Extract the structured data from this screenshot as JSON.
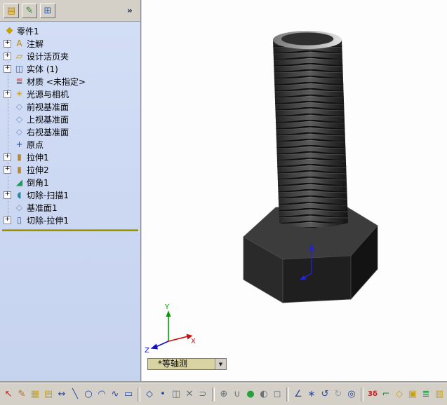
{
  "left_panel": {
    "toolbar": {
      "buttons": [
        {
          "id": "featuremanager-tab",
          "icon": "featuremanager-tree-icon",
          "glyph": "▤",
          "color": "#b8860b"
        },
        {
          "id": "propertymanager-tab",
          "icon": "propertymanager-icon",
          "glyph": "✎",
          "color": "#2a8a2a"
        },
        {
          "id": "configurationmanager-tab",
          "icon": "configurationmanager-icon",
          "glyph": "⊞",
          "color": "#3060b0"
        }
      ],
      "chevron": "»"
    },
    "tree": {
      "root": {
        "id": "part1",
        "label": "零件1",
        "glyph": "◆",
        "color": "#c8a000"
      },
      "expand_glyph": "+",
      "items": [
        {
          "id": "annotations",
          "label": "注解",
          "plus": true,
          "icon": "annotations-icon",
          "glyph": "A",
          "color": "#b8860b"
        },
        {
          "id": "design-binder",
          "label": "设计活页夹",
          "plus": true,
          "icon": "design-binder-icon",
          "glyph": "▱",
          "color": "#c09020"
        },
        {
          "id": "solid-bodies",
          "label": "实体 (1)",
          "plus": true,
          "icon": "solid-bodies-icon",
          "glyph": "◫",
          "color": "#3858b8"
        },
        {
          "id": "material",
          "label": "材质 <未指定>",
          "plus": false,
          "icon": "material-icon",
          "glyph": "≣",
          "color": "#c03030"
        },
        {
          "id": "lights-cameras",
          "label": "光源与相机",
          "plus": true,
          "icon": "lights-cameras-icon",
          "glyph": "☀",
          "color": "#d8a000"
        },
        {
          "id": "front-plane",
          "label": "前视基准面",
          "plus": false,
          "icon": "plane-icon",
          "glyph": "◇",
          "color": "#7090c8"
        },
        {
          "id": "top-plane",
          "label": "上视基准面",
          "plus": false,
          "icon": "plane-icon",
          "glyph": "◇",
          "color": "#7090c8"
        },
        {
          "id": "right-plane",
          "label": "右视基准面",
          "plus": false,
          "icon": "plane-icon",
          "glyph": "◇",
          "color": "#7090c8"
        },
        {
          "id": "origin",
          "label": "原点",
          "plus": false,
          "icon": "origin-icon",
          "glyph": "+",
          "color": "#2040c0"
        },
        {
          "id": "extrude1",
          "label": "拉伸1",
          "plus": true,
          "icon": "boss-extrude-icon",
          "glyph": "▮",
          "color": "#b8862a"
        },
        {
          "id": "extrude2",
          "label": "拉伸2",
          "plus": true,
          "icon": "boss-extrude-icon",
          "glyph": "▮",
          "color": "#b8862a"
        },
        {
          "id": "chamfer1",
          "label": "倒角1",
          "plus": false,
          "icon": "chamfer-icon",
          "glyph": "◢",
          "color": "#209858"
        },
        {
          "id": "cut-sweep1",
          "label": "切除-扫描1",
          "plus": true,
          "icon": "cut-sweep-icon",
          "glyph": "◖",
          "color": "#2888a0"
        },
        {
          "id": "plane1",
          "label": "基准面1",
          "plus": false,
          "icon": "plane-icon",
          "glyph": "◇",
          "color": "#7090c8"
        },
        {
          "id": "cut-extrude1",
          "label": "切除-拉伸1",
          "plus": true,
          "icon": "cut-extrude-icon",
          "glyph": "▯",
          "color": "#3858b8"
        }
      ]
    }
  },
  "viewport": {
    "view_combo": {
      "value": "*等轴测",
      "arrow": "▼"
    },
    "triad": {
      "x": "X",
      "y": "Y",
      "z": "Z"
    },
    "colors": {
      "x_axis": "#cc1010",
      "y_axis": "#00a000",
      "z_axis": "#1010cc",
      "origin_marker": "#2424cc"
    }
  },
  "bottom_toolbar": {
    "icons": [
      {
        "id": "select-arrow-icon",
        "glyph": "↖",
        "color": "#b02818"
      },
      {
        "id": "sketch-icon",
        "glyph": "✎",
        "color": "#c06818"
      },
      {
        "id": "grid-icon",
        "glyph": "▦",
        "color": "#c8a018"
      },
      {
        "id": "note-icon",
        "glyph": "▤",
        "color": "#c8a018"
      },
      {
        "id": "dimension-icon",
        "glyph": "↔",
        "color": "#2848a0"
      },
      {
        "id": "line-icon",
        "glyph": "╲",
        "color": "#2848a0"
      },
      {
        "id": "circle-icon",
        "glyph": "○",
        "color": "#2848a0"
      },
      {
        "id": "arc-icon",
        "glyph": "◠",
        "color": "#2848a0"
      },
      {
        "id": "spline-icon",
        "glyph": "∿",
        "color": "#2848a0"
      },
      {
        "id": "rectangle-icon",
        "glyph": "▭",
        "color": "#2848a0"
      },
      {
        "id": "polygon-icon",
        "glyph": "◇",
        "color": "#2848a0",
        "sep": true
      },
      {
        "id": "point-icon",
        "glyph": "•",
        "color": "#2848a0"
      },
      {
        "id": "mirror-icon",
        "glyph": "◫",
        "color": "#687078"
      },
      {
        "id": "trim-icon",
        "glyph": "✕",
        "color": "#687078"
      },
      {
        "id": "offset-icon",
        "glyph": "⊃",
        "color": "#687078"
      },
      {
        "id": "convert-entities-icon",
        "glyph": "⊕",
        "color": "#687078",
        "sep": true
      },
      {
        "id": "fillet-icon",
        "glyph": "∪",
        "color": "#687078"
      },
      {
        "id": "render-sphere-icon",
        "glyph": "●",
        "color": "#28a040"
      },
      {
        "id": "shaded-view-icon",
        "glyph": "◐",
        "color": "#687078"
      },
      {
        "id": "wireframe-view-icon",
        "glyph": "◻",
        "color": "#687078"
      },
      {
        "id": "constraint-icon",
        "glyph": "∠",
        "color": "#2848a0",
        "sep": true
      },
      {
        "id": "smart-dimension-icon",
        "glyph": "∗",
        "color": "#2848a0"
      },
      {
        "id": "undo-icon",
        "glyph": "↺",
        "color": "#2848a0"
      },
      {
        "id": "redo-icon",
        "glyph": "↻",
        "color": "#98a0a8"
      },
      {
        "id": "zoom-icon",
        "glyph": "◎",
        "color": "#2848a0"
      },
      {
        "id": "3d-dimension-icon",
        "glyph": "3δ",
        "color": "#c02020",
        "small": true,
        "sep": true
      },
      {
        "id": "corner-rectangle-icon",
        "glyph": "⌐",
        "color": "#209040"
      },
      {
        "id": "plane-tool-icon",
        "glyph": "◇",
        "color": "#c8a018"
      },
      {
        "id": "cube-tool-icon",
        "glyph": "▣",
        "color": "#c8a018"
      },
      {
        "id": "layers-icon",
        "glyph": "≣",
        "color": "#209040"
      },
      {
        "id": "block-icon",
        "glyph": "▥",
        "color": "#c8a018"
      }
    ]
  }
}
